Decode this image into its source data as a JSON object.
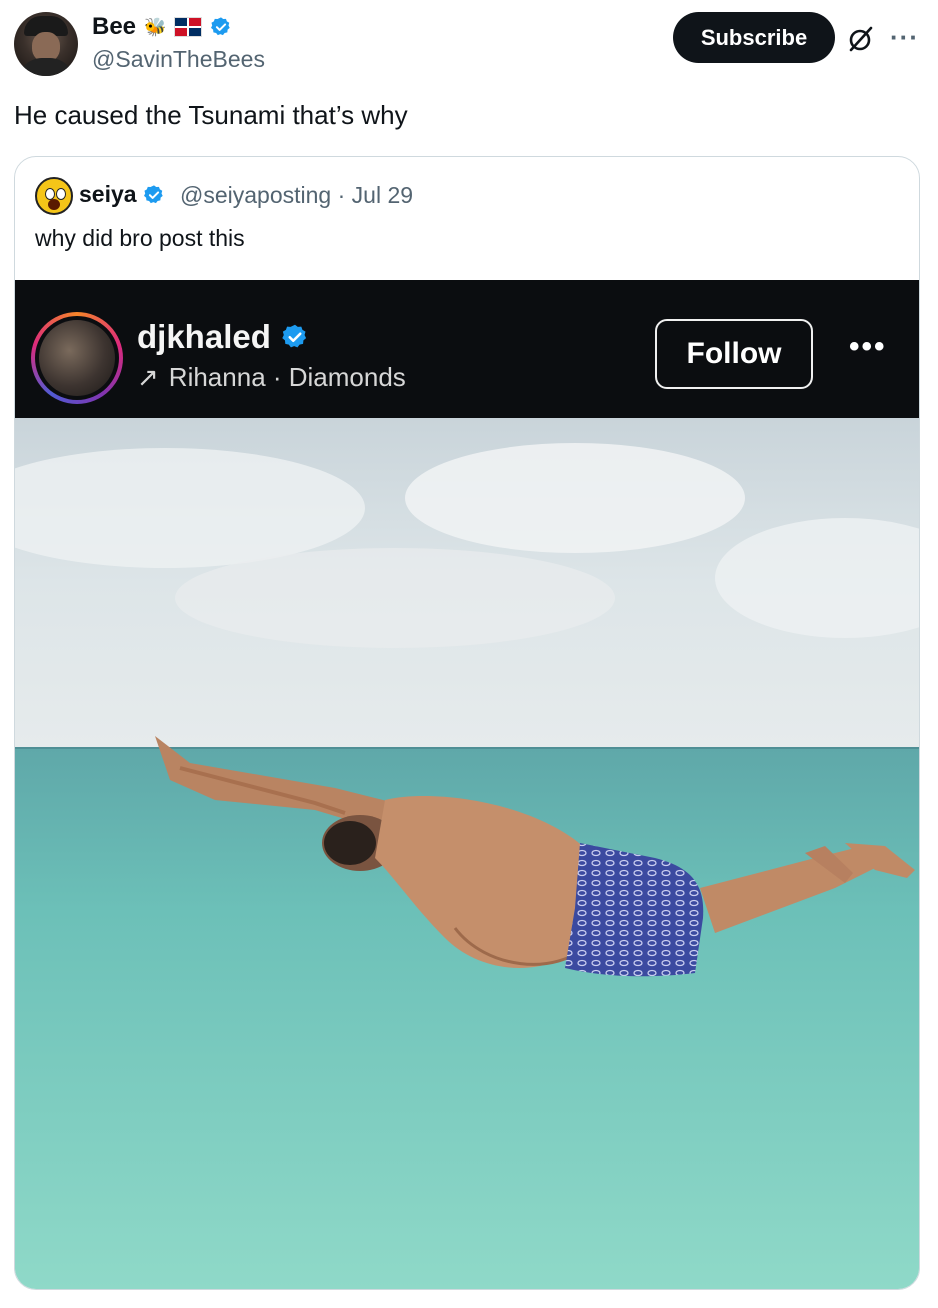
{
  "post": {
    "author_name": "Bee",
    "author_handle": "@SavinTheBees",
    "subscribe_label": "Subscribe",
    "more_label": "···",
    "text": "He caused the Tsunami that’s why"
  },
  "quote": {
    "author_name": "seiya",
    "author_handle": "@seiyaposting",
    "separator": "·",
    "date": "Jul 29",
    "text": "why did bro post this"
  },
  "instagram": {
    "username": "djkhaled",
    "music_arrow": "↗",
    "music": "Rihanna · Diamonds",
    "follow_label": "Follow",
    "more_label": "•••"
  },
  "colors": {
    "accent": "#1d9bf0",
    "subscribe_bg": "#0f1419",
    "ig_bar": "#0b0d10"
  }
}
